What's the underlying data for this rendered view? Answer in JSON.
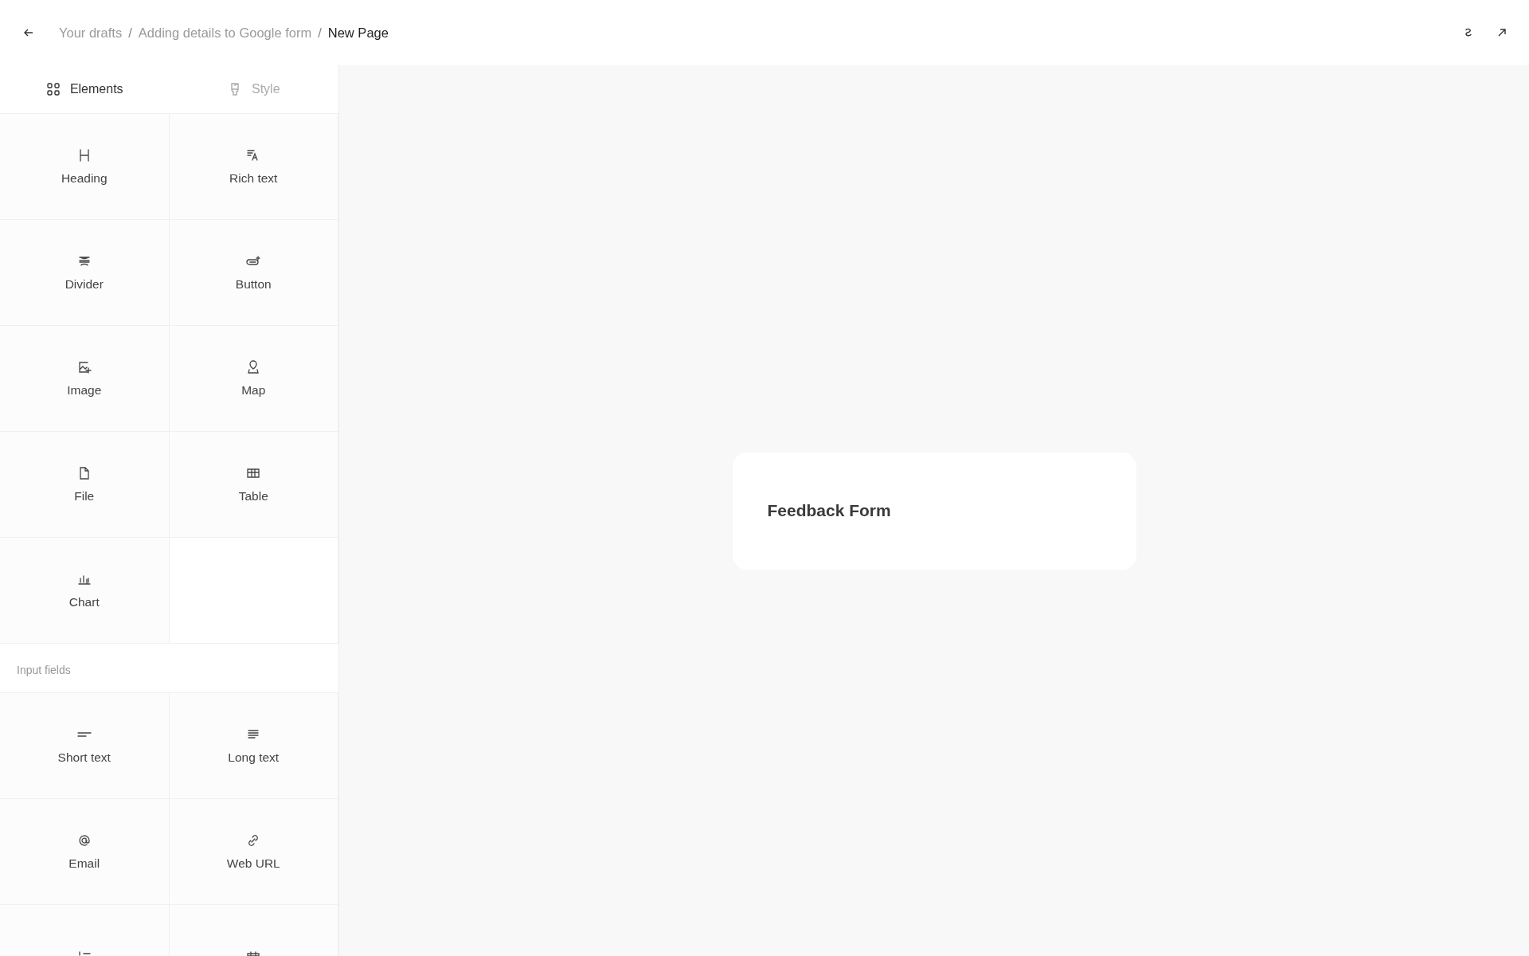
{
  "breadcrumb": [
    {
      "label": "Your drafts",
      "current": false
    },
    {
      "label": "Adding details to Google form",
      "current": false
    },
    {
      "label": "New Page",
      "current": true
    }
  ],
  "breadcrumb_separator": "/",
  "tabs": [
    {
      "label": "Elements",
      "kind": "grid",
      "selected": true
    },
    {
      "label": "Style",
      "kind": "brush",
      "selected": false
    }
  ],
  "elements": [
    {
      "label": "Heading",
      "kind": "heading"
    },
    {
      "label": "Rich text",
      "kind": "richtext"
    },
    {
      "label": "Divider",
      "kind": "divider"
    },
    {
      "label": "Button",
      "kind": "button"
    },
    {
      "label": "Image",
      "kind": "image"
    },
    {
      "label": "Map",
      "kind": "map"
    },
    {
      "label": "File",
      "kind": "file"
    },
    {
      "label": "Table",
      "kind": "table"
    },
    {
      "label": "Chart",
      "kind": "chart"
    }
  ],
  "input_fields": {
    "title": "Input fields",
    "items": [
      {
        "label": "Short text",
        "kind": "short"
      },
      {
        "label": "Long text",
        "kind": "long"
      },
      {
        "label": "Email",
        "kind": "email"
      },
      {
        "label": "Web URL",
        "kind": "url"
      },
      {
        "kind": "numbered"
      },
      {
        "kind": "calendar"
      }
    ]
  },
  "canvas": {
    "card_title": "Feedback Form"
  }
}
